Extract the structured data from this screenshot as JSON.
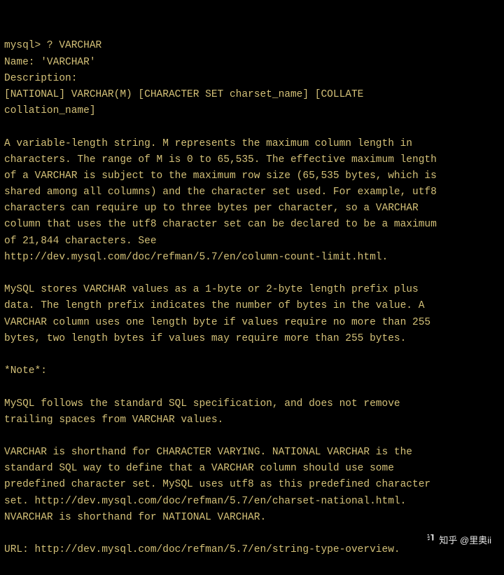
{
  "terminal": {
    "content": "mysql> ? VARCHAR\nName: 'VARCHAR'\nDescription:\n[NATIONAL] VARCHAR(M) [CHARACTER SET charset_name] [COLLATE\ncollation_name]\n\nA variable-length string. M represents the maximum column length in\ncharacters. The range of M is 0 to 65,535. The effective maximum length\nof a VARCHAR is subject to the maximum row size (65,535 bytes, which is\nshared among all columns) and the character set used. For example, utf8\ncharacters can require up to three bytes per character, so a VARCHAR\ncolumn that uses the utf8 character set can be declared to be a maximum\nof 21,844 characters. See\nhttp://dev.mysql.com/doc/refman/5.7/en/column-count-limit.html.\n\nMySQL stores VARCHAR values as a 1-byte or 2-byte length prefix plus\ndata. The length prefix indicates the number of bytes in the value. A\nVARCHAR column uses one length byte if values require no more than 255\nbytes, two length bytes if values may require more than 255 bytes.\n\n*Note*:\n\nMySQL follows the standard SQL specification, and does not remove\ntrailing spaces from VARCHAR values.\n\nVARCHAR is shorthand for CHARACTER VARYING. NATIONAL VARCHAR is the\nstandard SQL way to define that a VARCHAR column should use some\npredefined character set. MySQL uses utf8 as this predefined character\nset. http://dev.mysql.com/doc/refman/5.7/en/charset-national.html.\nNVARCHAR is shorthand for NATIONAL VARCHAR.\n\nURL: http://dev.mysql.com/doc/refman/5.7/en/string-type-overview."
  },
  "watermark": {
    "text": "知乎 @里奥ii"
  }
}
